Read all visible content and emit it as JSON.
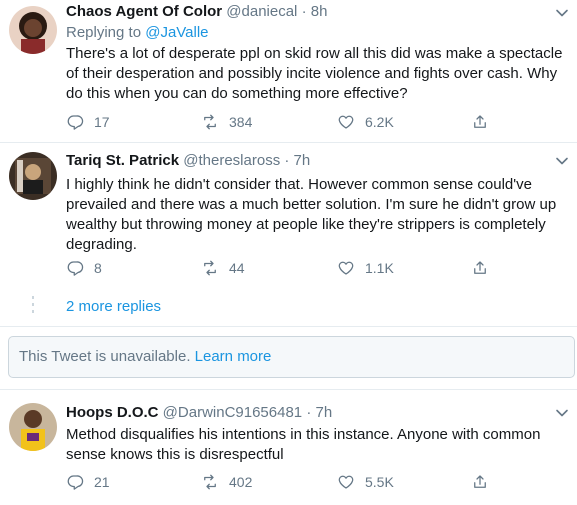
{
  "tweets": [
    {
      "name": "Chaos Agent Of Color",
      "handle": "@daniecal",
      "separator": "·",
      "time": "8h",
      "replying_prefix": "Replying to",
      "replying_to": "@JaValle",
      "text": "There's a lot of desperate ppl on skid row all this did was make a spectacle of their desperation and possibly incite violence and fights over cash. Why do this when you can do something more effective?",
      "replies": "17",
      "retweets": "384",
      "likes": "6.2K"
    },
    {
      "name": "Tariq St. Patrick",
      "handle": "@thereslaross",
      "separator": "·",
      "time": "7h",
      "text": "I highly think he didn't consider that. However common sense could've prevailed and there was a much better solution.  I'm sure he didn't grow up wealthy but throwing money at people like they're strippers is completely degrading.",
      "replies": "8",
      "retweets": "44",
      "likes": "1.1K"
    },
    {
      "name": "Hoops D.O.C",
      "handle": "@DarwinC91656481",
      "separator": "·",
      "time": "7h",
      "text": "Method disqualifies his intentions in this instance. Anyone with common sense knows this is disrespectful",
      "replies": "21",
      "retweets": "402",
      "likes": "5.5K"
    }
  ],
  "thread": {
    "more_replies": "2 more replies"
  },
  "unavailable": {
    "text": "This Tweet is unavailable.",
    "link": "Learn more"
  },
  "colors": {
    "link": "#1b95e0",
    "muted": "#657786",
    "text": "#14171a",
    "border": "#e6ecf0"
  },
  "icons": [
    "reply-icon",
    "retweet-icon",
    "like-icon",
    "share-icon",
    "chevron-down-icon"
  ]
}
